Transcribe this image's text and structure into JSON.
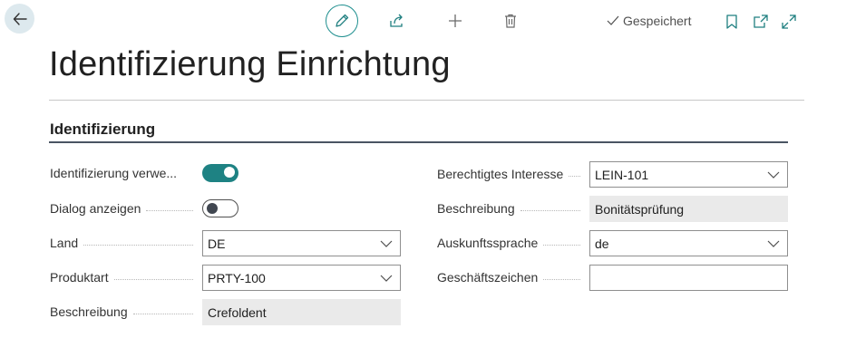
{
  "toolbar": {
    "saved_label": "Gespeichert"
  },
  "page": {
    "title": "Identifizierung Einrichtung",
    "section_title": "Identifizierung"
  },
  "left_fields": {
    "use_identification": {
      "label": "Identifizierung verwe...",
      "value": "on"
    },
    "show_dialog": {
      "label": "Dialog anzeigen",
      "value": "off"
    },
    "country": {
      "label": "Land",
      "value": "DE"
    },
    "product_type": {
      "label": "Produktart",
      "value": "PRTY-100"
    },
    "description": {
      "label": "Beschreibung",
      "value": "Crefoldent"
    }
  },
  "right_fields": {
    "legitimate_interest": {
      "label": "Berechtigtes Interesse",
      "value": "LEIN-101"
    },
    "description": {
      "label": "Beschreibung",
      "value": "Bonitätsprüfung"
    },
    "info_language": {
      "label": "Auskunftssprache",
      "value": "de"
    },
    "reference": {
      "label": "Geschäftszeichen",
      "value": ""
    }
  },
  "colors": {
    "accent": "#1e8283",
    "back_button_bg": "#dde9ee"
  }
}
